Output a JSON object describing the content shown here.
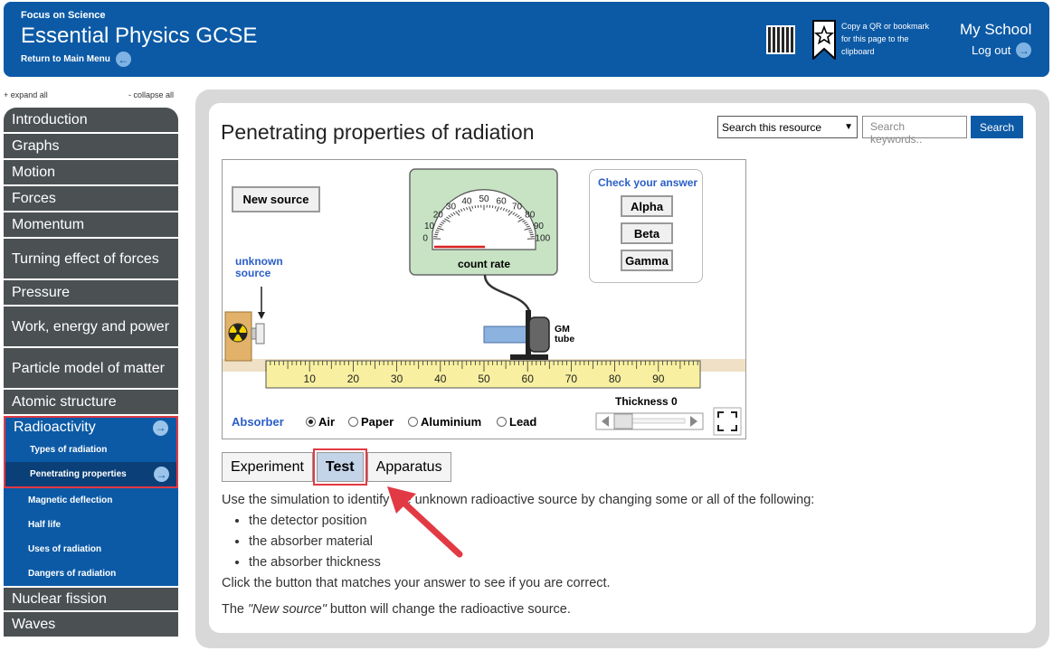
{
  "header": {
    "brand_sub": "Focus on Science",
    "brand_title": "Essential Physics GCSE",
    "return_label": "Return to Main Menu",
    "copy_text": "Copy a QR or bookmark for this page to the clipboard",
    "school": "My School",
    "logout": "Log out"
  },
  "sidebar": {
    "expand_all": "+ expand all",
    "collapse_all": "- collapse all",
    "items": [
      "Introduction",
      "Graphs",
      "Motion",
      "Forces",
      "Momentum",
      "Turning effect of forces",
      "Pressure",
      "Work, energy and power",
      "Particle model of matter",
      "Atomic structure"
    ],
    "active": "Radioactivity",
    "sub_items": [
      "Types of radiation",
      "Penetrating properties",
      "Magnetic deflection",
      "Half life",
      "Uses of radiation",
      "Dangers of radiation"
    ],
    "after_items": [
      "Nuclear fission",
      "Waves"
    ]
  },
  "main": {
    "title": "Penetrating properties of radiation",
    "search_scope": "Search this resource",
    "search_placeholder": "Search keywords..",
    "search_button": "Search"
  },
  "sim": {
    "new_source": "New source",
    "unknown_line1": "unknown",
    "unknown_line2": "source",
    "gauge_ticks": [
      "0",
      "10",
      "20",
      "30",
      "40",
      "50",
      "60",
      "70",
      "80",
      "90",
      "100"
    ],
    "count_rate_label": "count rate",
    "gm_line1": "GM",
    "gm_line2": "tube",
    "check_title": "Check your answer",
    "answers": [
      "Alpha",
      "Beta",
      "Gamma"
    ],
    "ruler_labels": [
      "10",
      "20",
      "30",
      "40",
      "50",
      "60",
      "70",
      "80",
      "90"
    ],
    "absorber_label": "Absorber",
    "absorbers": [
      "Air",
      "Paper",
      "Aluminium",
      "Lead"
    ],
    "selected_absorber": "Air",
    "thickness_label": "Thickness 0",
    "thickness_value": 0
  },
  "tabs": [
    "Experiment",
    "Test",
    "Apparatus"
  ],
  "active_tab": "Test",
  "instructions": {
    "intro": "Use the simulation to identify the unknown radioactive source by changing some or all of the following:",
    "bullets": [
      "the detector position",
      "the absorber material",
      "the absorber thickness"
    ],
    "click_note": "Click the button that matches your answer to see if you are correct.",
    "new_note_pre": "The ",
    "new_note_em": "\"New source\"",
    "new_note_post": " button will change the radioactive source."
  },
  "colors": {
    "brand_blue": "#0c5aa6",
    "nav_grey": "#4b5153",
    "highlight_red": "#e23a44",
    "gauge_green": "#c7e3c4"
  }
}
